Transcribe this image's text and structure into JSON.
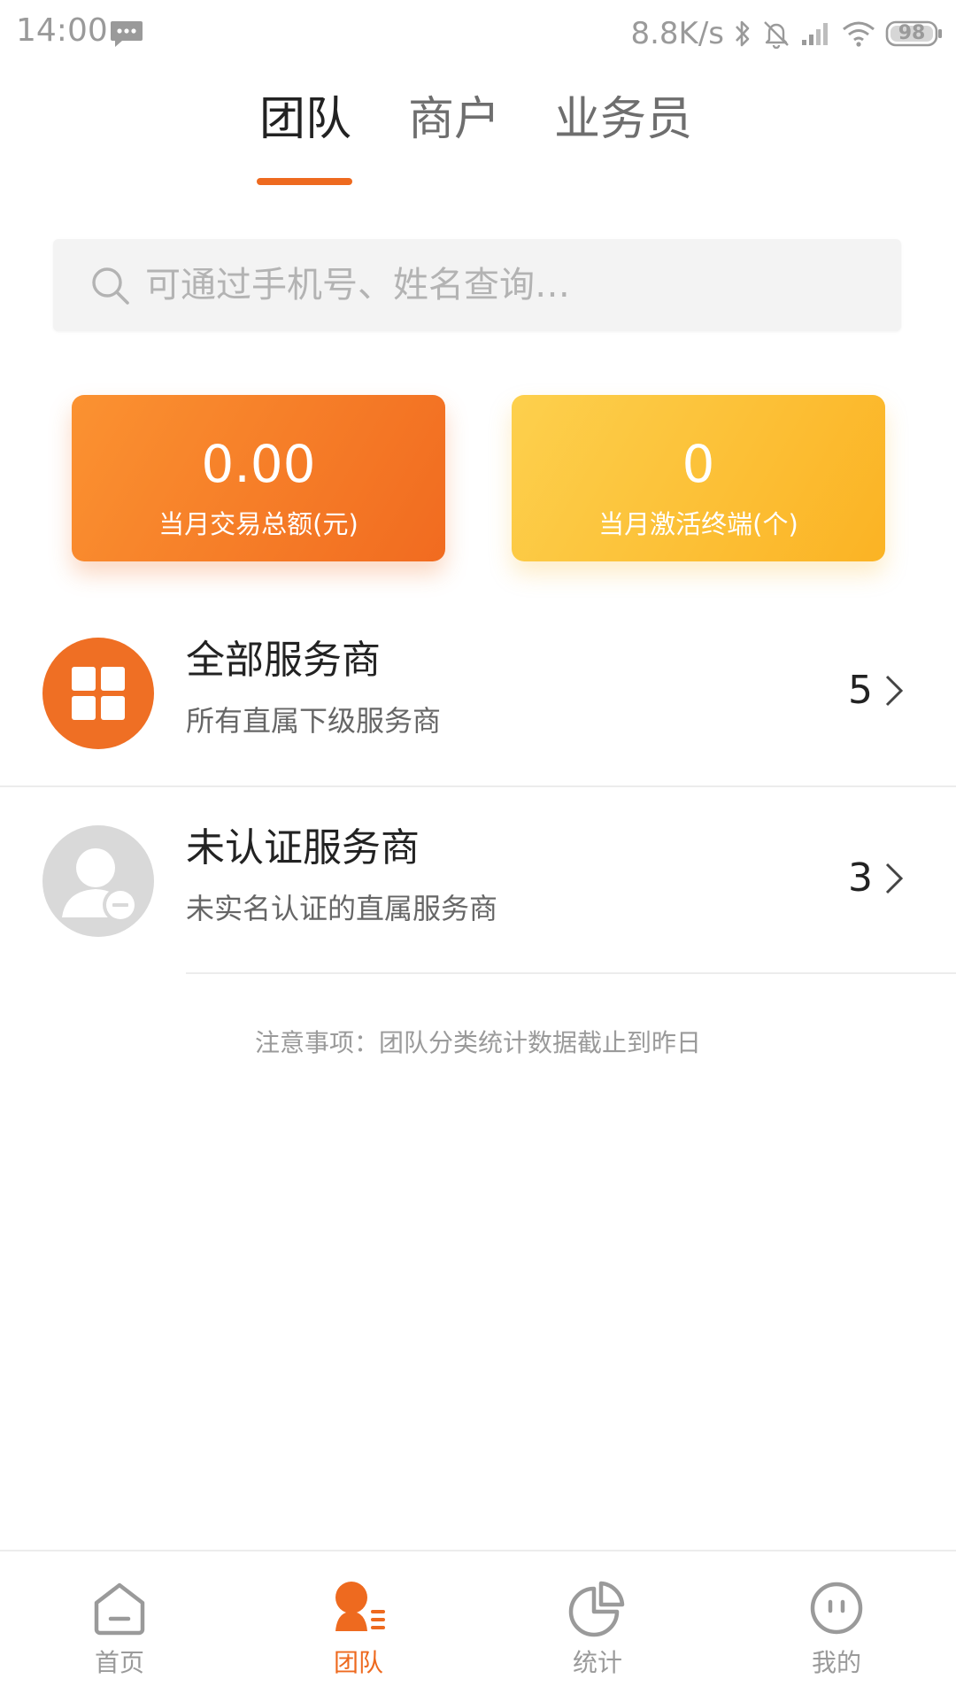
{
  "status_bar": {
    "time": "14:00",
    "network_speed": "8.8K/s",
    "battery": "98"
  },
  "tabs": [
    {
      "label": "团队",
      "active": true
    },
    {
      "label": "商户",
      "active": false
    },
    {
      "label": "业务员",
      "active": false
    }
  ],
  "search": {
    "placeholder": "可通过手机号、姓名查询…"
  },
  "stats": {
    "monthly_amount": {
      "value": "0.00",
      "label": "当月交易总额(元)"
    },
    "activated_terminals": {
      "value": "0",
      "label": "当月激活终端(个)"
    }
  },
  "rows": [
    {
      "title": "全部服务商",
      "subtitle": "所有直属下级服务商",
      "count": "5",
      "icon": "grid-icon"
    },
    {
      "title": "未认证服务商",
      "subtitle": "未实名认证的直属服务商",
      "count": "3",
      "icon": "user-minus-icon"
    }
  ],
  "notice": "注意事项：团队分类统计数据截止到昨日",
  "bottom_nav": [
    {
      "label": "首页",
      "icon": "home-icon",
      "active": false
    },
    {
      "label": "团队",
      "icon": "team-icon",
      "active": true
    },
    {
      "label": "统计",
      "icon": "pie-chart-icon",
      "active": false
    },
    {
      "label": "我的",
      "icon": "profile-icon",
      "active": false
    }
  ],
  "colors": {
    "accent": "#ee6a1f",
    "card_orange": "#f27a28",
    "card_yellow": "#fcc23a",
    "text_dark": "#222222",
    "text_gray": "#9a9a9a"
  }
}
